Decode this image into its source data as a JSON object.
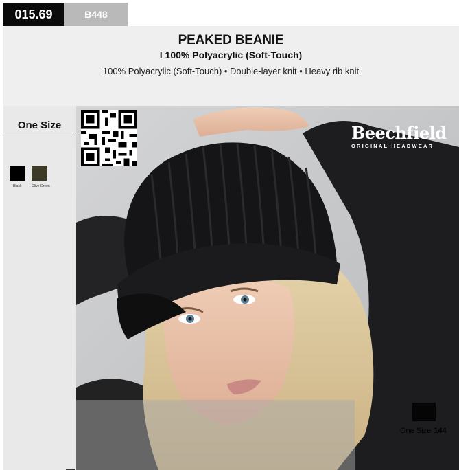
{
  "codes": {
    "price": "015.69",
    "sku": "B448"
  },
  "product": {
    "title": "PEAKED BEANIE",
    "subtitle": "l 100% Polyacrylic (Soft-Touch)",
    "description": "100% Polyacrylic (Soft-Touch) • Double-layer knit • Heavy rib knit"
  },
  "sizes": {
    "label": "One Size"
  },
  "colours": [
    {
      "name": "Black",
      "hex": "#000000"
    },
    {
      "name": "Olive Green",
      "hex": "#3d3a26"
    }
  ],
  "brand": {
    "name": "Beechfield",
    "tagline": "ORIGINAL HEADWEAR"
  },
  "packaging": {
    "size": "One Size",
    "quantity": "144"
  },
  "icons": [
    "qr-code-icon",
    "carton-icon"
  ]
}
